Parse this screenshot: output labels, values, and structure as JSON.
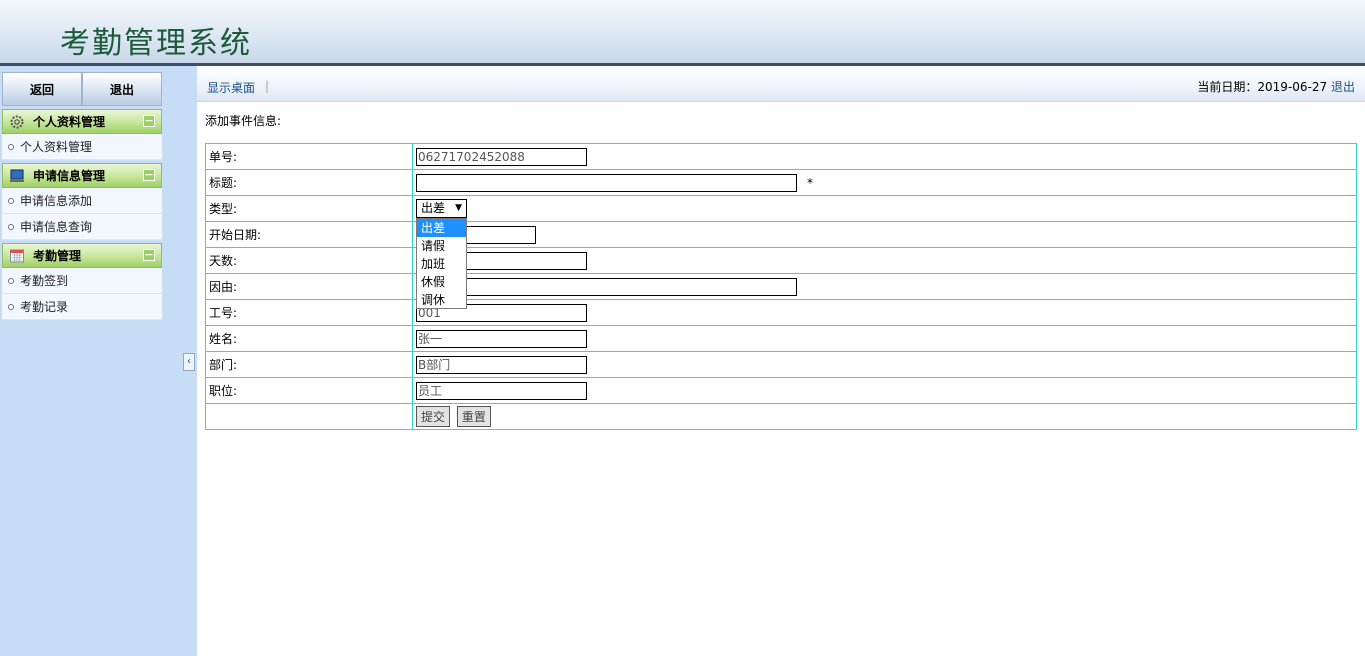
{
  "app": {
    "title": "考勤管理系统"
  },
  "sidebar": {
    "top_buttons": {
      "back": "返回",
      "exit": "退出"
    },
    "groups": [
      {
        "label": "个人资料管理",
        "icon": "gear-icon",
        "items": [
          "个人资料管理"
        ]
      },
      {
        "label": "申请信息管理",
        "icon": "monitor-icon",
        "items": [
          "申请信息添加",
          "申请信息查询"
        ]
      },
      {
        "label": "考勤管理",
        "icon": "calendar-icon",
        "items": [
          "考勤签到",
          "考勤记录"
        ]
      }
    ],
    "collapse_symbol": "‹"
  },
  "topbar": {
    "desktop_link": "显示桌面",
    "separator": "|",
    "date_label": "当前日期：2019-06-27",
    "logout": "退出"
  },
  "form": {
    "title": "添加事件信息:",
    "fields": {
      "number": {
        "label": "单号:",
        "value": "06271702452088"
      },
      "title": {
        "label": "标题:",
        "value": "",
        "required_mark": "*"
      },
      "type": {
        "label": "类型:",
        "value": "出差"
      },
      "start_date": {
        "label": "开始日期:",
        "value": ""
      },
      "days": {
        "label": "天数:",
        "value": ""
      },
      "reason": {
        "label": "因由:",
        "value": ""
      },
      "employee_id": {
        "label": "工号:",
        "value": "001"
      },
      "name": {
        "label": "姓名:",
        "value": "张一"
      },
      "department": {
        "label": "部门:",
        "value": "B部门"
      },
      "position": {
        "label": "职位:",
        "value": "员工"
      }
    },
    "submit": "提交",
    "reset": "重置"
  },
  "type_dropdown": {
    "arrow": "▼",
    "options": [
      "出差",
      "请假",
      "加班",
      "休假",
      "调休"
    ],
    "selected": "出差"
  },
  "colors": {
    "table_border": "#33d6d6",
    "sidebar_bg": "#c7dcf5",
    "group_head_green": "#9fd065",
    "link_blue": "#1c4f8c",
    "dropdown_highlight": "#1e90ff"
  }
}
